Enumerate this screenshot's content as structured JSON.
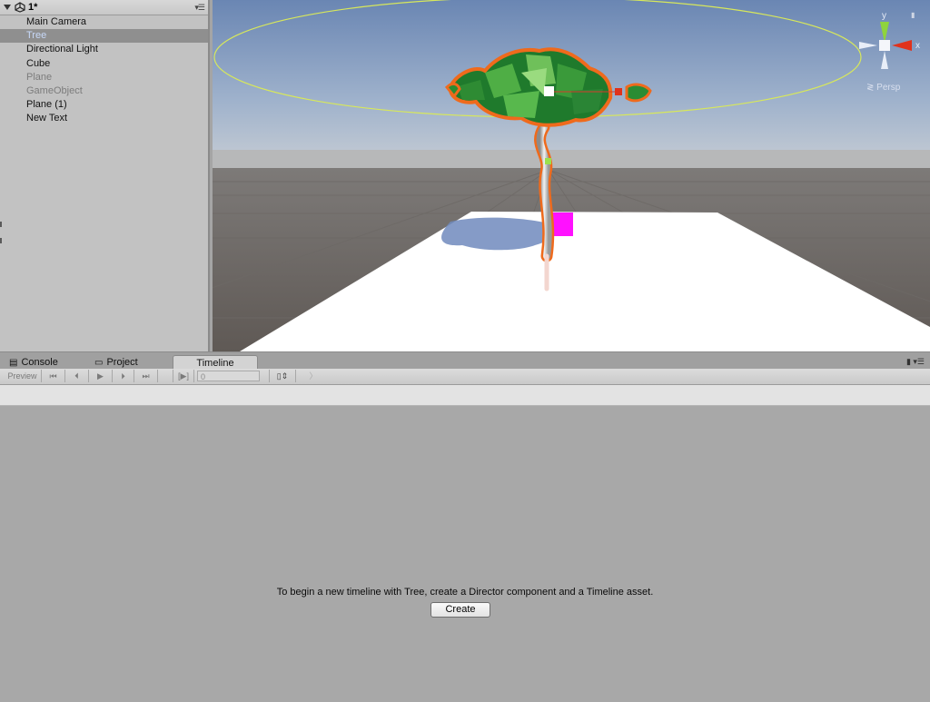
{
  "hierarchy": {
    "scene_name": "1*",
    "items": [
      {
        "label": "Main Camera"
      },
      {
        "label": "Tree"
      },
      {
        "label": "Directional Light"
      },
      {
        "label": "Cube"
      },
      {
        "label": "Plane"
      },
      {
        "label": "GameObject"
      },
      {
        "label": "Plane (1)"
      },
      {
        "label": "New Text"
      }
    ]
  },
  "scene": {
    "gizmo": {
      "x_label": "x",
      "y_label": "y",
      "persp_label": "≷ Persp"
    }
  },
  "tabs": [
    {
      "label": "Console"
    },
    {
      "label": "Project"
    },
    {
      "label": "Timeline"
    }
  ],
  "toolbar": {
    "preview_label": "Preview",
    "frame_value": "0"
  },
  "timeline": {
    "message": "To begin a new timeline with Tree, create a Director component and a Timeline asset.",
    "create_label": "Create"
  }
}
